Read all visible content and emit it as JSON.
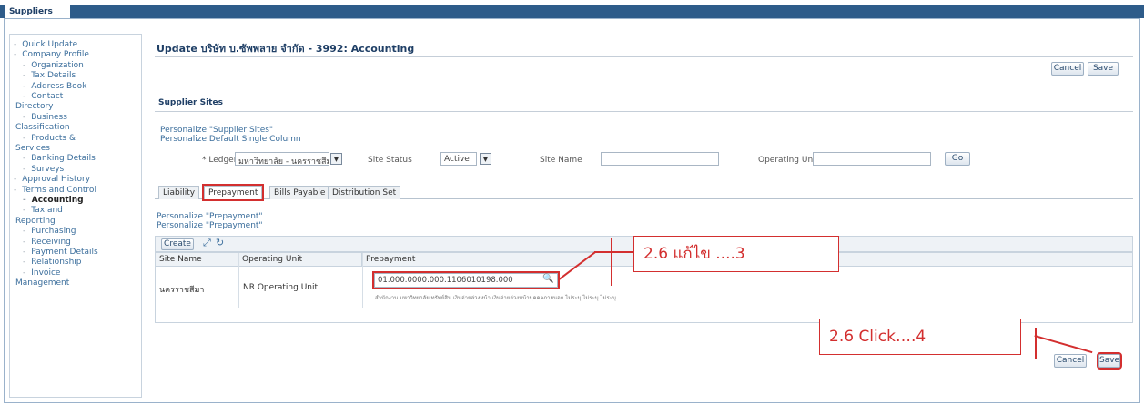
{
  "top_tab": {
    "label": "Suppliers"
  },
  "sidebar": {
    "items": [
      {
        "label": "Quick Update",
        "indent": 0
      },
      {
        "label": "Company Profile",
        "indent": 0
      },
      {
        "label": "Organization",
        "indent": 1
      },
      {
        "label": "Tax Details",
        "indent": 1
      },
      {
        "label": "Address Book",
        "indent": 1
      },
      {
        "label": "Contact",
        "indent": 1
      },
      {
        "label": "Directory",
        "indent": 0,
        "cont": true
      },
      {
        "label": "Business",
        "indent": 1
      },
      {
        "label": "Classification",
        "indent": 0,
        "cont": true
      },
      {
        "label": "Products &",
        "indent": 1
      },
      {
        "label": "Services",
        "indent": 0,
        "cont": true
      },
      {
        "label": "Banking Details",
        "indent": 1
      },
      {
        "label": "Surveys",
        "indent": 1
      },
      {
        "label": "Approval History",
        "indent": 0
      },
      {
        "label": "Terms and Control",
        "indent": 0
      },
      {
        "label": "Accounting",
        "indent": 1,
        "active": true
      },
      {
        "label": "Tax and",
        "indent": 1
      },
      {
        "label": "Reporting",
        "indent": 0,
        "cont": true
      },
      {
        "label": "Purchasing",
        "indent": 1
      },
      {
        "label": "Receiving",
        "indent": 1
      },
      {
        "label": "Payment Details",
        "indent": 1
      },
      {
        "label": "Relationship",
        "indent": 1
      },
      {
        "label": "Invoice",
        "indent": 1
      },
      {
        "label": "Management",
        "indent": 0,
        "cont": true
      }
    ]
  },
  "page": {
    "title": "Update บริษัท บ.ซัพพลาย จำกัด - 3992: Accounting",
    "cancel_label": "Cancel",
    "save_label": "Save"
  },
  "supplier_sites": {
    "section_title": "Supplier Sites",
    "personalize_1": "Personalize \"Supplier Sites\"",
    "personalize_2": "Personalize Default Single Column",
    "ledger_label": "* Ledger",
    "ledger_value": "มหาวิทยาลัย - นครราชสีมา",
    "site_status_label": "Site Status",
    "site_status_value": "Active",
    "site_name_label": "Site Name",
    "operating_unit_label": "Operating Unit",
    "go_label": "Go"
  },
  "tabs": [
    {
      "label": "Liability",
      "active": false
    },
    {
      "label": "Prepayment",
      "active": true
    },
    {
      "label": "Bills Payable",
      "active": false
    },
    {
      "label": "Distribution Set",
      "active": false
    }
  ],
  "prepayment": {
    "personalize_1": "Personalize \"Prepayment\"",
    "personalize_2": "Personalize \"Prepayment\"",
    "create_label": "Create",
    "columns": [
      "Site Name",
      "Operating Unit",
      "Prepayment"
    ],
    "row": {
      "site_name": "นครราชสีมา",
      "operating_unit": "NR Operating Unit",
      "prepayment": "01.000.0000.000.1106010198.000",
      "description": "สำนักงาน.มหาวิทยาลัย.ทรัพย์สิน.เงินจ่ายล่วงหน้า.เงินจ่ายล่วงหน้าบุคคลภายนอก.ไม่ระบุ.ไม่ระบุ.ไม่ระบุ"
    }
  },
  "annotations": {
    "edit_note": "2.6 แก้ไข ....3",
    "click_note": "2.6 Click….4",
    "accent_color": "#d32f2f"
  }
}
